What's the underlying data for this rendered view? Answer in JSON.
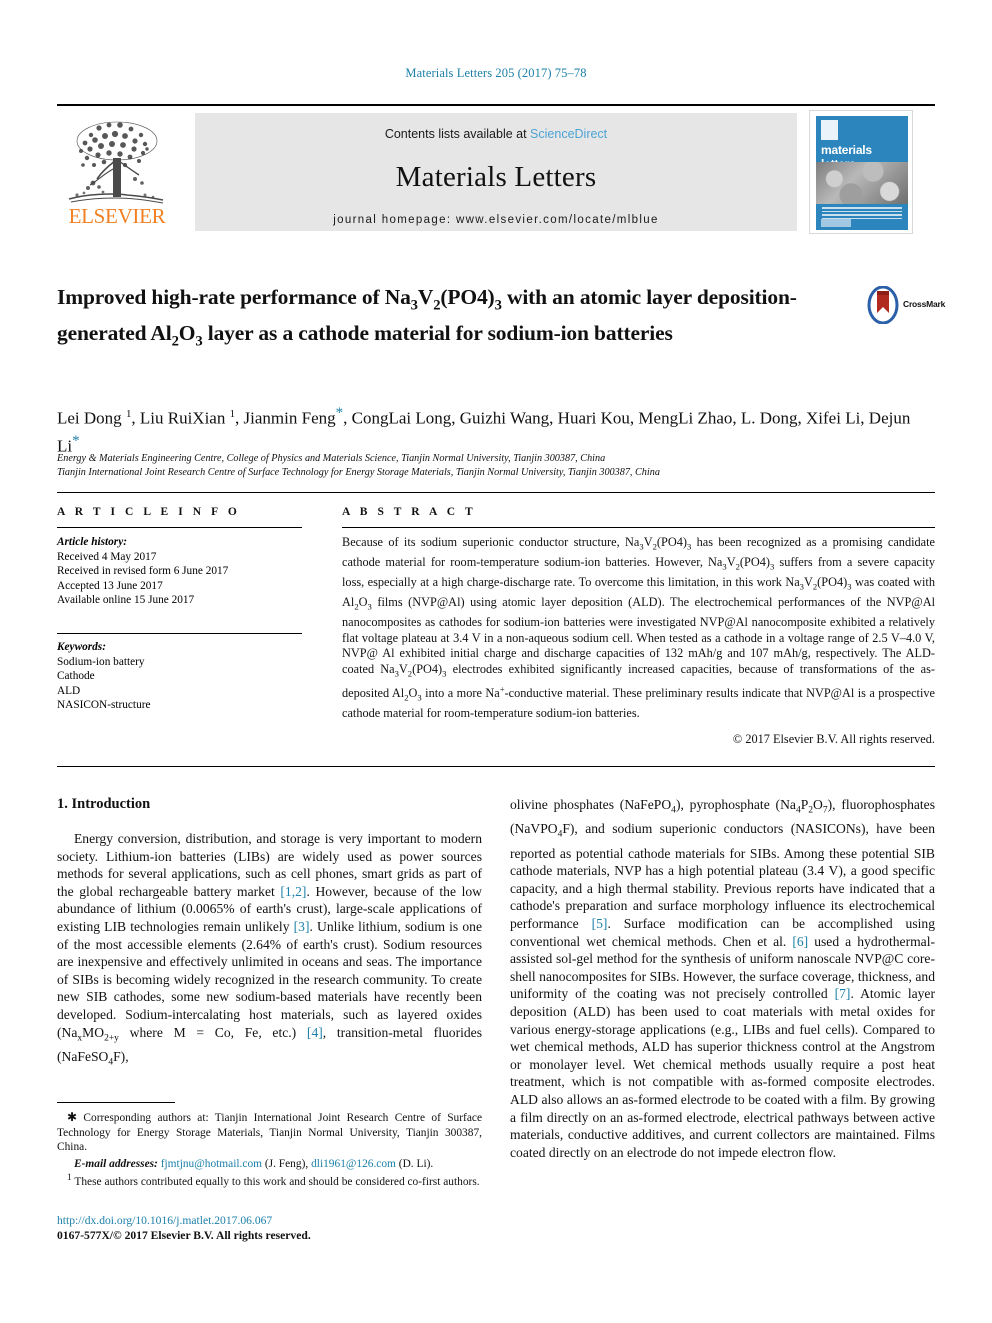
{
  "running_head": "Materials Letters 205 (2017) 75–78",
  "masthead": {
    "publisher": "ELSEVIER",
    "contents_prefix": "Contents lists available at ",
    "contents_link": "ScienceDirect",
    "journal_title": "Materials Letters",
    "homepage_label": "journal homepage: www.elsevier.com/locate/mlblue",
    "cover_title": "materials letters"
  },
  "article": {
    "title_part1": "Improved high-rate performance of Na",
    "title": "Improved high-rate performance of Na3V2(PO4)3 with an atomic layer deposition-generated Al2O3 layer as a cathode material for sodium-ion batteries",
    "crossmark_label": "CrossMark",
    "authors": "Lei Dong 1, Liu RuiXian 1, Jianmin Feng*, CongLai Long, Guizhi Wang, Huari Kou, MengLi Zhao, L. Dong, Xifei Li, Dejun Li*",
    "affiliation_1": "Energy & Materials Engineering Centre, College of Physics and Materials Science, Tianjin Normal University, Tianjin 300387, China",
    "affiliation_2": "Tianjin International Joint Research Centre of Surface Technology for Energy Storage Materials, Tianjin Normal University, Tianjin 300387, China"
  },
  "article_info": {
    "heading": "A R T I C L E   I N F O",
    "history_label": "Article history:",
    "history": [
      "Received 4 May 2017",
      "Received in revised form 6 June 2017",
      "Accepted 13 June 2017",
      "Available online 15 June 2017"
    ],
    "keywords_label": "Keywords:",
    "keywords": [
      "Sodium-ion battery",
      "Cathode",
      "ALD",
      "NASICON-structure"
    ]
  },
  "abstract": {
    "heading": "A B S T R A C T",
    "text": "Because of its sodium superionic conductor structure, Na3V2(PO4)3 has been recognized as a promising candidate cathode material for room-temperature sodium-ion batteries. However, Na3V2(PO4)3 suffers from a severe capacity loss, especially at a high charge-discharge rate. To overcome this limitation, in this work Na3V2(PO4)3 was coated with Al2O3 films (NVP@Al) using atomic layer deposition (ALD). The electrochemical performances of the NVP@Al nanocomposites as cathodes for sodium-ion batteries were investigated NVP@Al nanocomposite exhibited a relatively flat voltage plateau at 3.4 V in a non-aqueous sodium cell. When tested as a cathode in a voltage range of 2.5 V–4.0 V, NVP@ Al exhibited initial charge and discharge capacities of 132 mAh/g and 107 mAh/g, respectively. The ALD-coated Na3V2(PO4)3 electrodes exhibited significantly increased capacities, because of transformations of the as-deposited Al2O3 into a more Na+-conductive material. These preliminary results indicate that NVP@Al is a prospective cathode material for room-temperature sodium-ion batteries.",
    "copyright": "© 2017 Elsevier B.V. All rights reserved."
  },
  "body": {
    "section_heading": "1. Introduction",
    "left_paragraph": "Energy conversion, distribution, and storage is very important to modern society. Lithium-ion batteries (LIBs) are widely used as power sources methods for several applications, such as cell phones, smart grids as part of the global rechargeable battery market [1,2]. However, because of the low abundance of lithium (0.0065% of earth's crust), large-scale applications of existing LIB technologies remain unlikely [3]. Unlike lithium, sodium is one of the most accessible elements (2.64% of earth's crust). Sodium resources are inexpensive and effectively unlimited in oceans and seas. The importance of SIBs is becoming widely recognized in the research community. To create new SIB cathodes, some new sodium-based materials have recently been developed. Sodium-intercalating host materials, such as layered oxides (NaxMO2+y where M = Co, Fe, etc.) [4], transition-metal fluorides (NaFeSO4F),",
    "right_paragraph": "olivine phosphates (NaFePO4), pyrophosphate (Na4P2O7), fluorophosphates (NaVPO4F), and sodium superionic conductors (NASICONs), have been reported as potential cathode materials for SIBs. Among these potential SIB cathode materials, NVP has a high potential plateau (3.4 V), a good specific capacity, and a high thermal stability. Previous reports have indicated that a cathode's preparation and surface morphology influence its electrochemical performance [5]. Surface modification can be accomplished using conventional wet chemical methods. Chen et al. [6] used a hydrothermal-assisted sol-gel method for the synthesis of uniform nanoscale NVP@C core-shell nanocomposites for SIBs. However, the surface coverage, thickness, and uniformity of the coating was not precisely controlled [7]. Atomic layer deposition (ALD) has been used to coat materials with metal oxides for various energy-storage applications (e.g., LIBs and fuel cells). Compared to wet chemical methods, ALD has superior thickness control at the Angstrom or monolayer level. Wet chemical methods usually require a post heat treatment, which is not compatible with as-formed composite electrodes. ALD also allows an as-formed electrode to be coated with a film. By growing a film directly on an as-formed electrode, electrical pathways between active materials, conductive additives, and current collectors are maintained. Films coated directly on an electrode do not impede electron flow."
  },
  "footnotes": {
    "corresponding": "Corresponding authors at: Tianjin International Joint Research Centre of Surface Technology for Energy Storage Materials, Tianjin Normal University, Tianjin 300387, China.",
    "email_label": "E-mail addresses:",
    "email_1": "fjmtjnu@hotmail.com",
    "email_1_name": "(J. Feng),",
    "email_2": "dli1961@126.com",
    "email_2_name": "(D. Li).",
    "co_first": "These authors contributed equally to this work and should be considered co-first authors.",
    "doi": "http://dx.doi.org/10.1016/j.matlet.2017.06.067",
    "issn_line": "0167-577X/© 2017 Elsevier B.V. All rights reserved."
  },
  "colors": {
    "link_blue": "#1b7fa8",
    "sciencedirect_blue": "#4ba3d3",
    "elsevier_orange": "#f08023",
    "banner_grey": "#e6e6e6",
    "cover_blue": "#2d85be"
  }
}
